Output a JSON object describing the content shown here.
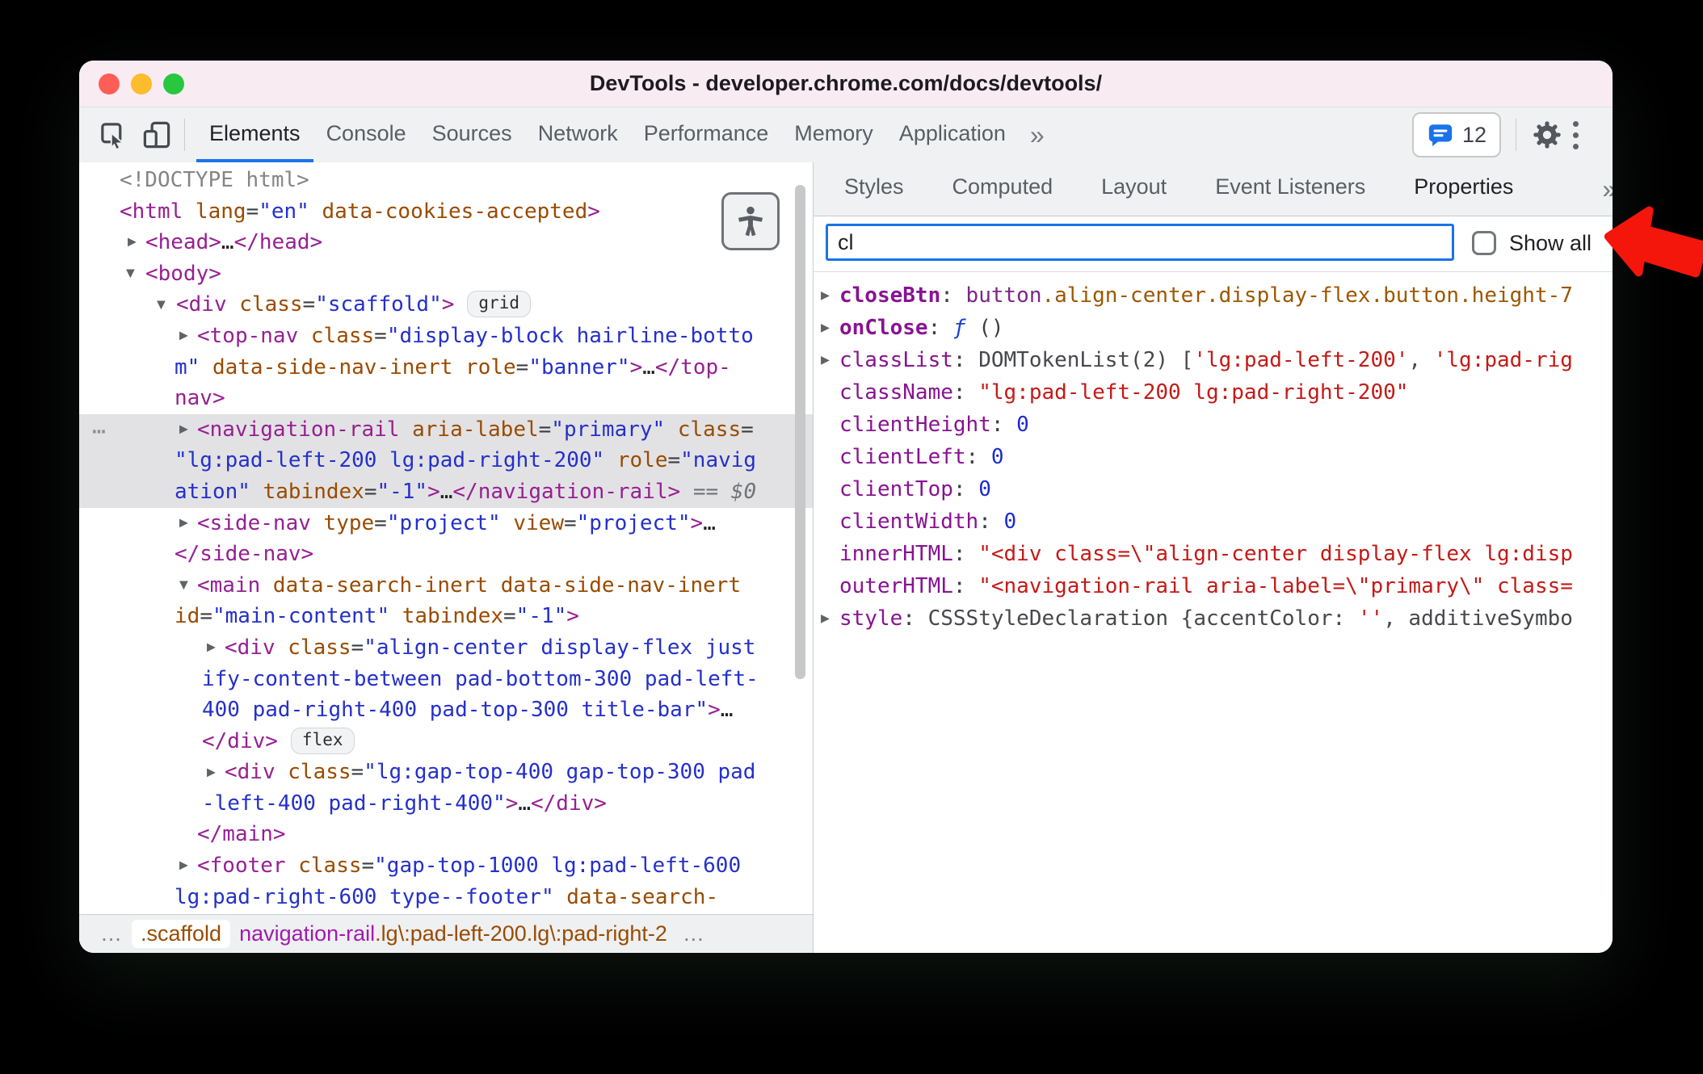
{
  "window": {
    "title": "DevTools - developer.chrome.com/docs/devtools/"
  },
  "toolbar": {
    "tabs": [
      "Elements",
      "Console",
      "Sources",
      "Network",
      "Performance",
      "Memory",
      "Application"
    ],
    "active_tab": "Elements",
    "overflow_chevron": "»",
    "chat_count": "12"
  },
  "right_panel": {
    "tabs": [
      "Styles",
      "Computed",
      "Layout",
      "Event Listeners",
      "Properties"
    ],
    "active_tab": "Properties",
    "overflow_chevron": "»",
    "filter": {
      "value": "cl",
      "show_all_label": "Show all"
    }
  },
  "elements_panel": {
    "dom_tree": [
      {
        "lines": [
          {
            "ind": 50,
            "tokens": [
              {
                "c": "gray",
                "v": "<!DOCTYPE html>"
              }
            ]
          }
        ]
      },
      {
        "lines": [
          {
            "ind": 50,
            "tokens": [
              {
                "c": "tag",
                "v": "<html"
              },
              {
                "c": "attr",
                "v": " lang"
              },
              {
                "c": "punc",
                "v": "="
              },
              {
                "c": "val",
                "v": "\"en\""
              },
              {
                "c": "attr",
                "v": " data-cookies-accepted"
              },
              {
                "c": "tag",
                "v": ">"
              }
            ]
          }
        ]
      },
      {
        "arrow": "collapsed",
        "arrowInd": 60,
        "lines": [
          {
            "ind": 82,
            "tokens": [
              {
                "c": "tag",
                "v": "<head>"
              },
              {
                "c": "ell",
                "v": "…"
              },
              {
                "c": "tag",
                "v": "</head>"
              }
            ]
          }
        ]
      },
      {
        "arrow": "expanded",
        "arrowInd": 58,
        "lines": [
          {
            "ind": 82,
            "tokens": [
              {
                "c": "tag",
                "v": "<body>"
              }
            ]
          }
        ]
      },
      {
        "arrow": "expanded",
        "arrowInd": 96,
        "lines": [
          {
            "ind": 120,
            "badge": "grid",
            "tokens": [
              {
                "c": "tag",
                "v": "<div"
              },
              {
                "c": "attr",
                "v": " class"
              },
              {
                "c": "punc",
                "v": "="
              },
              {
                "c": "val",
                "v": "\"scaffold\""
              },
              {
                "c": "tag",
                "v": ">"
              }
            ]
          }
        ]
      },
      {
        "arrow": "collapsed",
        "arrowInd": 124,
        "lines": [
          {
            "ind": 146,
            "tokens": [
              {
                "c": "tag",
                "v": "<top-nav"
              },
              {
                "c": "attr",
                "v": " class"
              },
              {
                "c": "punc",
                "v": "="
              },
              {
                "c": "val",
                "v": "\"display-block hairline-botto"
              }
            ]
          },
          {
            "ind": 118,
            "tokens": [
              {
                "c": "val",
                "v": "m\""
              },
              {
                "c": "attr",
                "v": " data-side-nav-inert"
              },
              {
                "c": "attr",
                "v": " role"
              },
              {
                "c": "punc",
                "v": "="
              },
              {
                "c": "val",
                "v": "\"banner\""
              },
              {
                "c": "tag",
                "v": ">"
              },
              {
                "c": "ell",
                "v": "…"
              },
              {
                "c": "tag",
                "v": "</top-"
              }
            ]
          },
          {
            "ind": 118,
            "tokens": [
              {
                "c": "tag",
                "v": "nav>"
              }
            ]
          }
        ]
      },
      {
        "selected": true,
        "dots": true,
        "arrow": "collapsed",
        "arrowInd": 124,
        "lines": [
          {
            "ind": 146,
            "tokens": [
              {
                "c": "tag",
                "v": "<navigation-rail"
              },
              {
                "c": "attr",
                "v": " aria-label"
              },
              {
                "c": "punc",
                "v": "="
              },
              {
                "c": "val",
                "v": "\"primary\""
              },
              {
                "c": "attr",
                "v": " class"
              },
              {
                "c": "punc",
                "v": "="
              }
            ]
          },
          {
            "ind": 118,
            "tokens": [
              {
                "c": "val",
                "v": "\"lg:pad-left-200 lg:pad-right-200\""
              },
              {
                "c": "attr",
                "v": " role"
              },
              {
                "c": "punc",
                "v": "="
              },
              {
                "c": "val",
                "v": "\"navig"
              }
            ]
          },
          {
            "ind": 118,
            "tokens": [
              {
                "c": "val",
                "v": "ation\""
              },
              {
                "c": "attr",
                "v": " tabindex"
              },
              {
                "c": "punc",
                "v": "="
              },
              {
                "c": "val",
                "v": "\"-1\""
              },
              {
                "c": "tag",
                "v": ">"
              },
              {
                "c": "ell",
                "v": "…"
              },
              {
                "c": "tag",
                "v": "</navigation-rail>"
              },
              {
                "c": "eq",
                "v": " == "
              },
              {
                "c": "dollar",
                "v": "$0"
              }
            ]
          }
        ]
      },
      {
        "arrow": "collapsed",
        "arrowInd": 124,
        "lines": [
          {
            "ind": 146,
            "tokens": [
              {
                "c": "tag",
                "v": "<side-nav"
              },
              {
                "c": "attr",
                "v": " type"
              },
              {
                "c": "punc",
                "v": "="
              },
              {
                "c": "val",
                "v": "\"project\""
              },
              {
                "c": "attr",
                "v": " view"
              },
              {
                "c": "punc",
                "v": "="
              },
              {
                "c": "val",
                "v": "\"project\""
              },
              {
                "c": "tag",
                "v": ">"
              },
              {
                "c": "ell",
                "v": "…"
              }
            ]
          },
          {
            "ind": 118,
            "tokens": [
              {
                "c": "tag",
                "v": "</side-nav>"
              }
            ]
          }
        ]
      },
      {
        "arrow": "expanded",
        "arrowInd": 124,
        "lines": [
          {
            "ind": 146,
            "tokens": [
              {
                "c": "tag",
                "v": "<main"
              },
              {
                "c": "attr",
                "v": " data-search-inert"
              },
              {
                "c": "attr",
                "v": " data-side-nav-inert"
              }
            ]
          },
          {
            "ind": 118,
            "tokens": [
              {
                "c": "attr",
                "v": "id"
              },
              {
                "c": "punc",
                "v": "="
              },
              {
                "c": "val",
                "v": "\"main-content\""
              },
              {
                "c": "attr",
                "v": " tabindex"
              },
              {
                "c": "punc",
                "v": "="
              },
              {
                "c": "val",
                "v": "\"-1\""
              },
              {
                "c": "tag",
                "v": ">"
              }
            ]
          }
        ]
      },
      {
        "arrow": "collapsed",
        "arrowInd": 158,
        "lines": [
          {
            "ind": 180,
            "tokens": [
              {
                "c": "tag",
                "v": "<div"
              },
              {
                "c": "attr",
                "v": " class"
              },
              {
                "c": "punc",
                "v": "="
              },
              {
                "c": "val",
                "v": "\"align-center display-flex just"
              }
            ]
          },
          {
            "ind": 152,
            "tokens": [
              {
                "c": "val",
                "v": "ify-content-between pad-bottom-300 pad-left-"
              }
            ]
          },
          {
            "ind": 152,
            "tokens": [
              {
                "c": "val",
                "v": "400 pad-right-400 pad-top-300 title-bar\""
              },
              {
                "c": "tag",
                "v": ">"
              },
              {
                "c": "ell",
                "v": "…"
              }
            ]
          },
          {
            "ind": 152,
            "badge": "flex",
            "tokens": [
              {
                "c": "tag",
                "v": "</div>"
              }
            ]
          }
        ]
      },
      {
        "arrow": "collapsed",
        "arrowInd": 158,
        "lines": [
          {
            "ind": 180,
            "tokens": [
              {
                "c": "tag",
                "v": "<div"
              },
              {
                "c": "attr",
                "v": " class"
              },
              {
                "c": "punc",
                "v": "="
              },
              {
                "c": "val",
                "v": "\"lg:gap-top-400 gap-top-300 pad"
              }
            ]
          },
          {
            "ind": 152,
            "tokens": [
              {
                "c": "val",
                "v": "-left-400 pad-right-400\""
              },
              {
                "c": "tag",
                "v": ">"
              },
              {
                "c": "ell",
                "v": "…"
              },
              {
                "c": "tag",
                "v": "</div>"
              }
            ]
          }
        ]
      },
      {
        "lines": [
          {
            "ind": 146,
            "tokens": [
              {
                "c": "tag",
                "v": "</main>"
              }
            ]
          }
        ]
      },
      {
        "arrow": "collapsed",
        "arrowInd": 124,
        "lines": [
          {
            "ind": 146,
            "tokens": [
              {
                "c": "tag",
                "v": "<footer"
              },
              {
                "c": "attr",
                "v": " class"
              },
              {
                "c": "punc",
                "v": "="
              },
              {
                "c": "val",
                "v": "\"gap-top-1000 lg:pad-left-600"
              }
            ]
          },
          {
            "ind": 118,
            "tokens": [
              {
                "c": "val",
                "v": "lg:pad-right-600 type--footer\""
              },
              {
                "c": "attr",
                "v": " data-search-"
              }
            ]
          }
        ]
      }
    ],
    "breadcrumbs": {
      "left_ellipsis": "…",
      "crumbs": [
        {
          "chip": true,
          "parts": [
            {
              "c": "cls",
              "v": ".scaffold"
            }
          ]
        },
        {
          "chip": false,
          "parts": [
            {
              "c": "tag",
              "v": "navigation-rail"
            },
            {
              "c": "cls",
              "v": ".lg\\:pad-left-200.lg\\:pad-right-2"
            }
          ]
        }
      ],
      "right_ellipsis": "…"
    }
  },
  "properties_panel": {
    "rows": [
      {
        "expand": true,
        "tokens": [
          {
            "c": "nameb",
            "v": "closeBtn"
          },
          {
            "c": "punc",
            "v": ": "
          },
          {
            "c": "ntag",
            "v": "button"
          },
          {
            "c": "ncls",
            "v": ".align-center.display-flex.button.height-7"
          }
        ]
      },
      {
        "expand": true,
        "tokens": [
          {
            "c": "nameb",
            "v": "onClose"
          },
          {
            "c": "punc",
            "v": ": "
          },
          {
            "c": "fn",
            "v": "ƒ"
          },
          {
            "c": "punc",
            "v": " ()"
          }
        ]
      },
      {
        "expand": true,
        "tokens": [
          {
            "c": "name",
            "v": "classList"
          },
          {
            "c": "punc",
            "v": ": "
          },
          {
            "c": "obj",
            "v": "DOMTokenList(2) ["
          },
          {
            "c": "str",
            "v": "'lg:pad-left-200'"
          },
          {
            "c": "obj",
            "v": ", "
          },
          {
            "c": "str",
            "v": "'lg:pad-rig"
          }
        ]
      },
      {
        "tokens": [
          {
            "c": "name",
            "v": "className"
          },
          {
            "c": "punc",
            "v": ": "
          },
          {
            "c": "str",
            "v": "\"lg:pad-left-200 lg:pad-right-200\""
          }
        ]
      },
      {
        "tokens": [
          {
            "c": "name",
            "v": "clientHeight"
          },
          {
            "c": "punc",
            "v": ": "
          },
          {
            "c": "num",
            "v": "0"
          }
        ]
      },
      {
        "tokens": [
          {
            "c": "name",
            "v": "clientLeft"
          },
          {
            "c": "punc",
            "v": ": "
          },
          {
            "c": "num",
            "v": "0"
          }
        ]
      },
      {
        "tokens": [
          {
            "c": "name",
            "v": "clientTop"
          },
          {
            "c": "punc",
            "v": ": "
          },
          {
            "c": "num",
            "v": "0"
          }
        ]
      },
      {
        "tokens": [
          {
            "c": "name",
            "v": "clientWidth"
          },
          {
            "c": "punc",
            "v": ": "
          },
          {
            "c": "num",
            "v": "0"
          }
        ]
      },
      {
        "tokens": [
          {
            "c": "name",
            "v": "innerHTML"
          },
          {
            "c": "punc",
            "v": ": "
          },
          {
            "c": "str",
            "v": "\"<div class=\\\"align-center display-flex lg:disp"
          }
        ]
      },
      {
        "tokens": [
          {
            "c": "name",
            "v": "outerHTML"
          },
          {
            "c": "punc",
            "v": ": "
          },
          {
            "c": "str",
            "v": "\"<navigation-rail aria-label=\\\"primary\\\" class="
          }
        ]
      },
      {
        "expand": true,
        "tokens": [
          {
            "c": "name",
            "v": "style"
          },
          {
            "c": "punc",
            "v": ": "
          },
          {
            "c": "obj",
            "v": "CSSStyleDeclaration {accentColor: "
          },
          {
            "c": "str",
            "v": "''"
          },
          {
            "c": "obj",
            "v": ", additiveSymbo"
          }
        ]
      }
    ]
  },
  "colors": {
    "accent_blue": "#1a73e8",
    "titlebar_pink": "#f8ecf2",
    "toolbar_gray": "#eff1f3",
    "selection_gray": "#e2e2e4",
    "arrow_red": "#f4150b",
    "traffic_red": "#ff5e57",
    "traffic_yellow": "#fdbc2e",
    "traffic_green": "#28c73f"
  }
}
